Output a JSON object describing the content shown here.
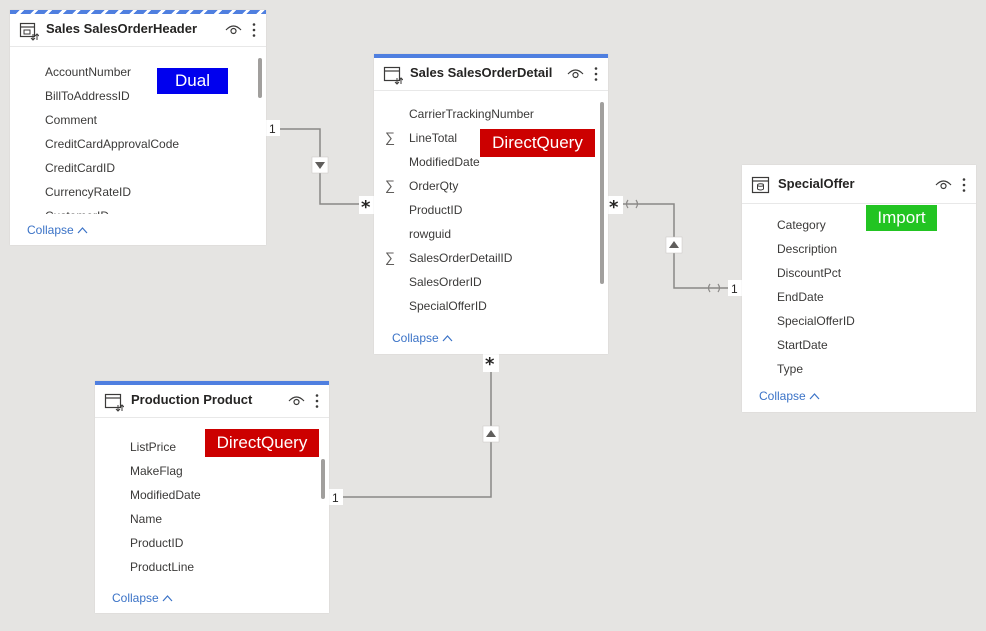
{
  "colors": {
    "background": "#e5e4e2",
    "accent": "#4f7fe0",
    "link": "#3b73c7",
    "dual": "#0000ee",
    "directquery": "#cc0000",
    "import": "#22c422",
    "line": "#8a8886"
  },
  "tables": {
    "header": {
      "title": "Sales SalesOrderHeader",
      "mode": "Dual",
      "fields": [
        "AccountNumber",
        "BillToAddressID",
        "Comment",
        "CreditCardApprovalCode",
        "CreditCardID",
        "CurrencyRateID",
        "CustomerID"
      ],
      "collapse": "Collapse"
    },
    "detail": {
      "title": "Sales SalesOrderDetail",
      "mode": "DirectQuery",
      "fields": [
        "CarrierTrackingNumber",
        "LineTotal",
        "ModifiedDate",
        "OrderQty",
        "ProductID",
        "rowguid",
        "SalesOrderDetailID",
        "SalesOrderID",
        "SpecialOfferID"
      ],
      "sum_fields": [
        "LineTotal",
        "OrderQty",
        "SalesOrderDetailID"
      ],
      "collapse": "Collapse"
    },
    "offer": {
      "title": "SpecialOffer",
      "mode": "Import",
      "fields": [
        "Category",
        "Description",
        "DiscountPct",
        "EndDate",
        "SpecialOfferID",
        "StartDate",
        "Type"
      ],
      "collapse": "Collapse"
    },
    "product": {
      "title": "Production Product",
      "mode": "DirectQuery",
      "fields": [
        "ListPrice",
        "MakeFlag",
        "ModifiedDate",
        "Name",
        "ProductID",
        "ProductLine"
      ],
      "collapse": "Collapse"
    }
  },
  "relationships": {
    "one": "1",
    "many": "*"
  },
  "icons": {
    "table": "table-icon",
    "eye": "eye-icon",
    "more": "more-vertical-icon",
    "sum": "sum-icon",
    "chevron": "chevron-up-icon",
    "filter": "filter-direction-icon"
  }
}
